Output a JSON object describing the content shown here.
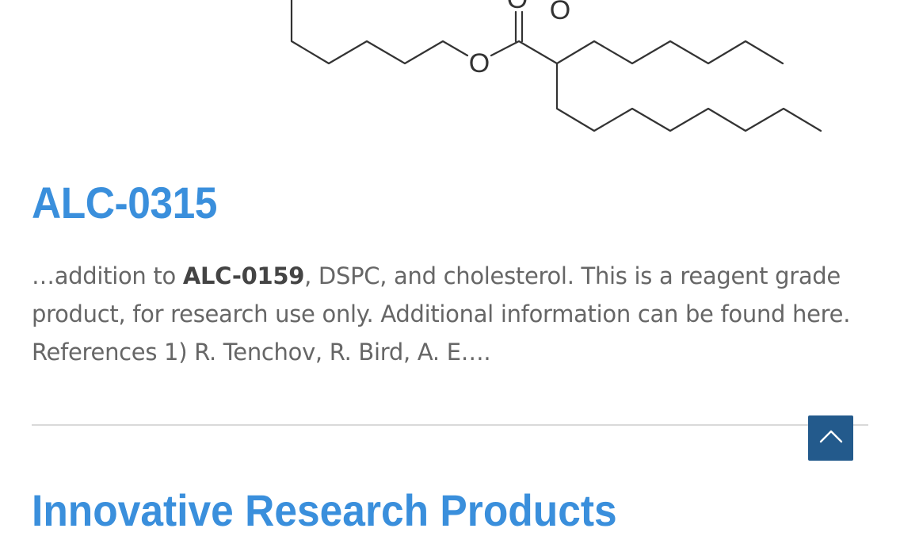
{
  "structure": {
    "o_labels": [
      "O",
      "O",
      "O"
    ]
  },
  "result": {
    "title": "ALC-0315",
    "excerpt_prefix": "…addition to ",
    "excerpt_bold": "ALC-0159",
    "excerpt_line1_rest": ", DSPC, and cholesterol. This is a reagent grade",
    "excerpt_line2": "product, for research use only. Additional information can be found here.",
    "excerpt_line3": "References 1) R. Tenchov, R. Bird, A. E…."
  },
  "next_result": {
    "title": "Innovative Research Products"
  },
  "scroll_top": {
    "icon": "chevron-up-icon"
  },
  "colors": {
    "title": "#3a8fdc",
    "text": "#666666",
    "divider": "#d9d9d9",
    "scroll_button": "#235a8c"
  }
}
